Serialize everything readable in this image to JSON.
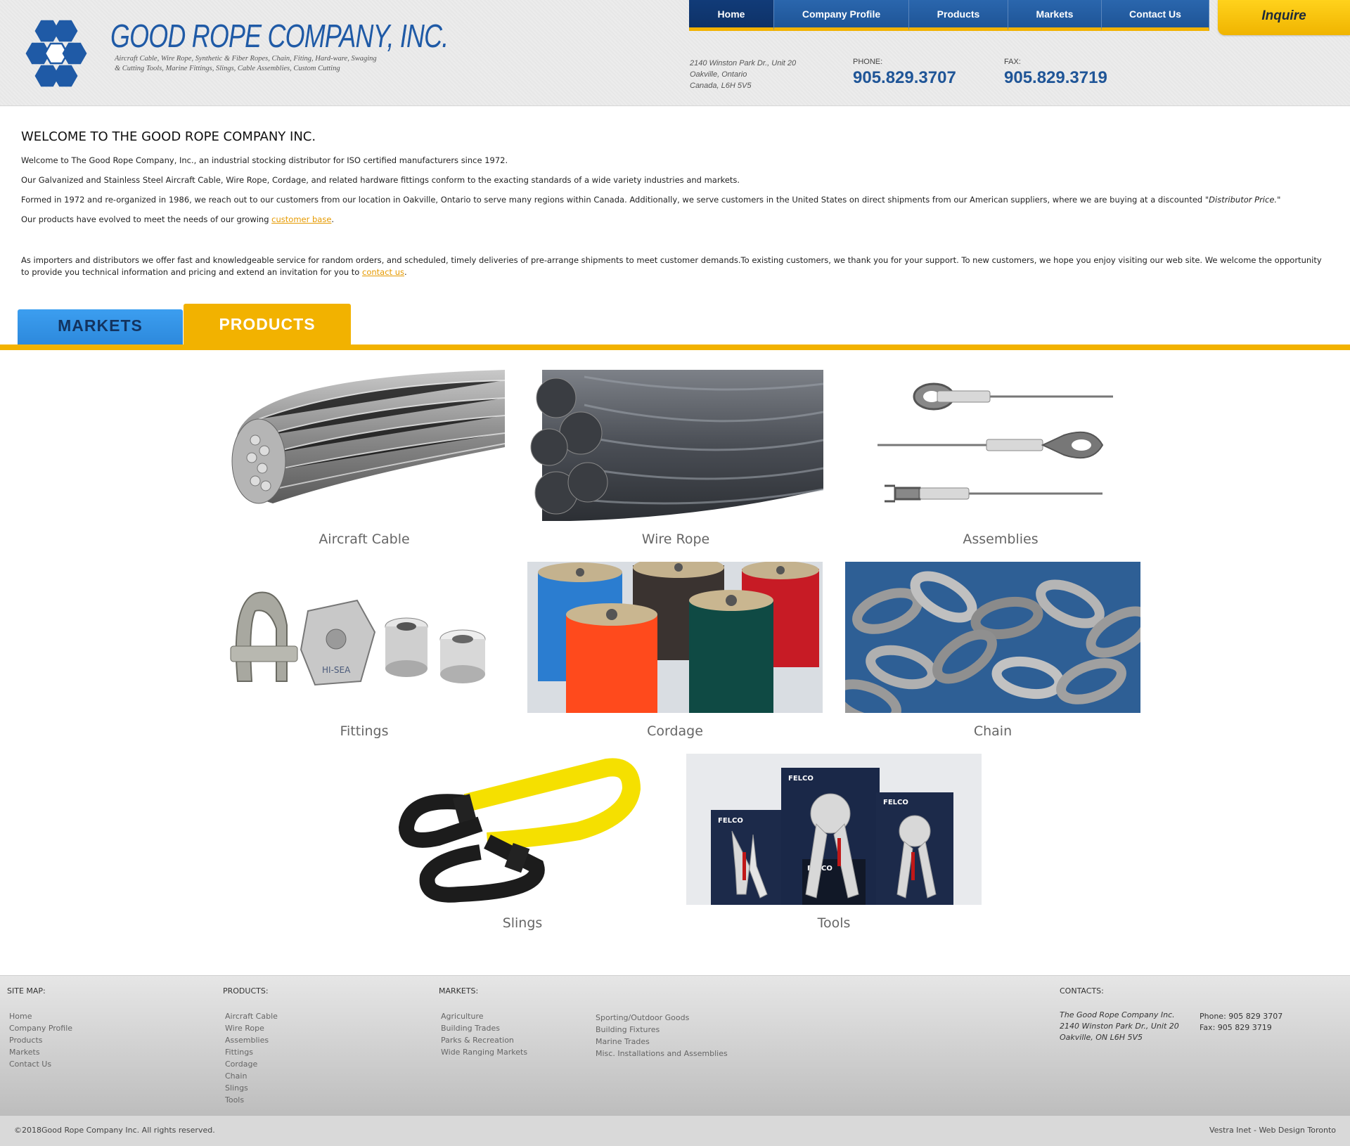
{
  "header": {
    "company_name": "GOOD ROPE COMPANY, INC.",
    "tagline": "Aircraft Cable, Wire Rope, Synthetic & Fiber Ropes, Chain, Fiting, Hard-ware, Swaging & Cutting Tools, Marine Fittings, Slings, Cable Assemblies, Custom Cutting",
    "logo_icon": "hexagon-cluster-logo",
    "address_line1": "2140 Winston Park Dr., Unit 20",
    "address_line2": "Oakville, Ontario",
    "address_line3": "Canada, L6H 5V5",
    "phone_label": "PHONE:",
    "phone": "905.829.3707",
    "fax_label": "FAX:",
    "fax": "905.829.3719"
  },
  "nav": {
    "items": [
      {
        "label": "Home",
        "active": true
      },
      {
        "label": "Company Profile",
        "active": false
      },
      {
        "label": "Products",
        "active": false
      },
      {
        "label": "Markets",
        "active": false
      },
      {
        "label": "Contact Us",
        "active": false
      }
    ],
    "inquire": "Inquire"
  },
  "welcome": {
    "heading": "WELCOME TO THE GOOD ROPE COMPANY INC.",
    "p1": "Welcome to The Good Rope Company, Inc., an industrial stocking distributor for ISO certified manufacturers since 1972.",
    "p2": "Our Galvanized and Stainless Steel Aircraft Cable, Wire Rope, Cordage, and related hardware fittings conform to the exacting standards of a wide variety industries and markets.",
    "p3_text": "Formed in 1972 and re-organized in 1986, we reach out to our customers from our location in Oakville, Ontario to serve many regions within Canada. Additionally, we serve customers in the United States on direct shipments from our American suppliers, where we are buying at a discounted \"",
    "p3_em": "Distributor Price.",
    "p3_end": "\"",
    "p4_text": "Our products have evolved to meet the needs of our growing ",
    "p4_link": "customer base",
    "p4_end": ".",
    "p5_text": "As importers and distributors we offer fast and knowledgeable service for random orders, and scheduled, timely deliveries of pre-arrange shipments to meet customer demands.To existing customers, we thank you for your support. To new customers, we hope you enjoy visiting our web site. We welcome the opportunity to provide you technical information and pricing and extend an invitation for you to ",
    "p5_link": "contact us",
    "p5_end": "."
  },
  "tabs": {
    "markets": "MARKETS",
    "products": "PRODUCTS",
    "active": "products"
  },
  "products": [
    {
      "label": "Aircraft Cable",
      "icon": "aircraft-cable-image"
    },
    {
      "label": "Wire Rope",
      "icon": "wire-rope-image"
    },
    {
      "label": "Assemblies",
      "icon": "assemblies-image"
    },
    {
      "label": "Fittings",
      "icon": "fittings-image"
    },
    {
      "label": "Cordage",
      "icon": "cordage-image"
    },
    {
      "label": "Chain",
      "icon": "chain-image"
    },
    {
      "label": "Slings",
      "icon": "slings-image"
    },
    {
      "label": "Tools",
      "icon": "tools-image"
    }
  ],
  "product_images": {
    "tool_brand": "FELCO",
    "fitting_stamp": "HI-SEA"
  },
  "footer": {
    "sitemap_heading": "SITE MAP:",
    "sitemap": [
      "Home",
      "Company Profile",
      "Products",
      "Markets",
      "Contact Us"
    ],
    "products_heading": "PRODUCTS:",
    "products": [
      "Aircraft Cable",
      "Wire Rope",
      "Assemblies",
      "Fittings",
      "Cordage",
      "Chain",
      "Slings",
      "Tools"
    ],
    "markets_heading": "MARKETS:",
    "markets_col1": [
      "Agriculture",
      "Building Trades",
      "Parks & Recreation",
      "Wide Ranging Markets"
    ],
    "markets_col2": [
      "Sporting/Outdoor Goods",
      "Building Fixtures",
      "Marine Trades",
      "Misc. Installations and Assemblies"
    ],
    "contacts_heading": "CONTACTS:",
    "contact_name": "The Good Rope Company Inc.",
    "contact_street": "2140 Winston Park Dr., Unit 20",
    "contact_city": "Oakville, ON L6H 5V5",
    "contact_phone": "Phone: 905 829 3707",
    "contact_fax": "Fax: 905 829 3719",
    "copyright": "©2018Good Rope Company Inc. All rights reserved.",
    "credit": "Vestra Inet - Web Design Toronto"
  },
  "colors": {
    "brand_blue": "#1f5597",
    "accent_yellow": "#f2b200",
    "markets_tab": "#3c9ef0",
    "link_orange": "#e69a00"
  }
}
